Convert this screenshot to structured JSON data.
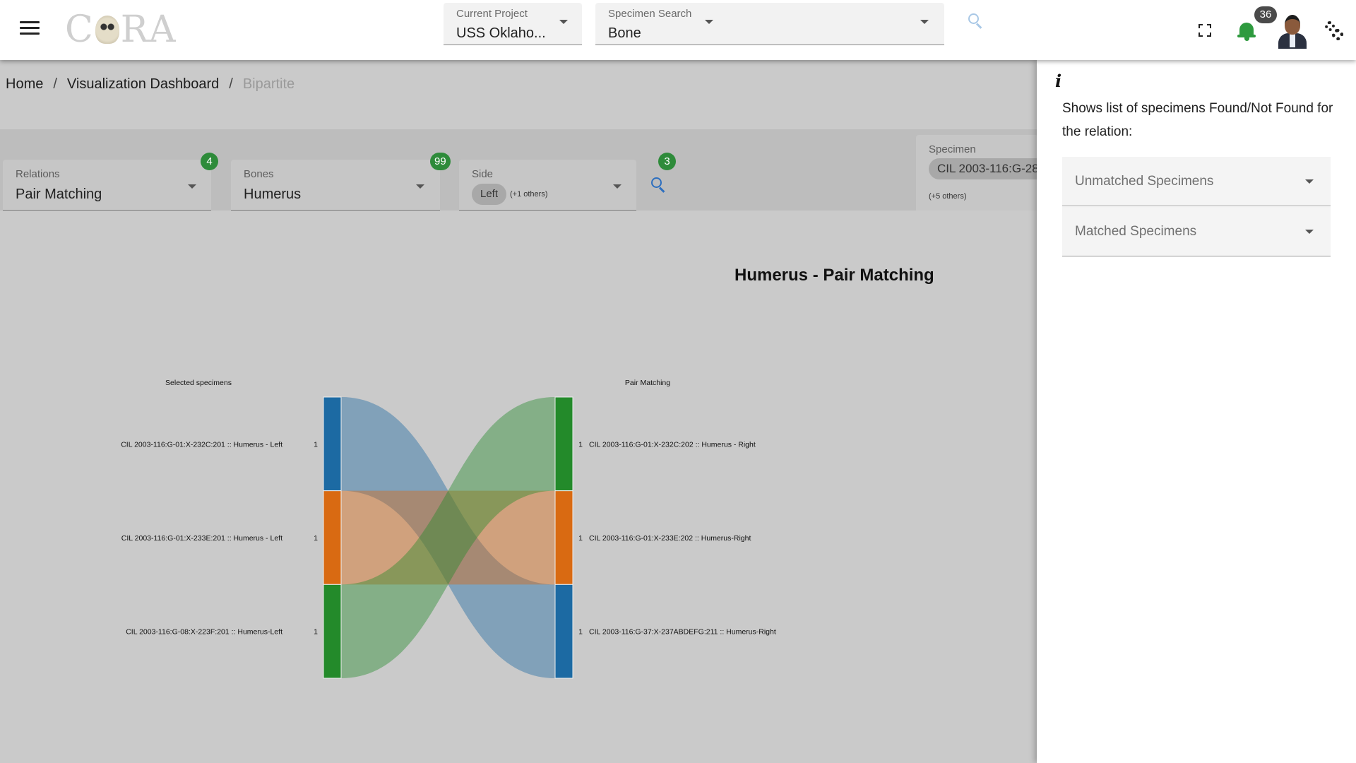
{
  "header": {
    "logo_text_left": "C",
    "logo_text_right": "RA",
    "current_project": {
      "label": "Current Project",
      "value": "USS Oklaho..."
    },
    "specimen_search": {
      "label": "Specimen Search",
      "value": "Bone"
    },
    "notifications_count": "36"
  },
  "breadcrumb": {
    "home": "Home",
    "dashboard": "Visualization Dashboard",
    "current": "Bipartite",
    "separator": "/"
  },
  "filters": {
    "relations": {
      "label": "Relations",
      "value": "Pair Matching",
      "count": "4"
    },
    "bones": {
      "label": "Bones",
      "value": "Humerus",
      "count": "99"
    },
    "side": {
      "label": "Side",
      "chip": "Left",
      "others": "(+1 others)"
    },
    "search_count": "3",
    "specimen": {
      "label": "Specimen",
      "chip": "CIL 2003-116:G-28",
      "others": "(+5 others)"
    }
  },
  "chart_data": {
    "type": "sankey",
    "title": "Humerus - Pair Matching",
    "left_header": "Selected specimens",
    "right_header": "Pair Matching",
    "left_nodes": [
      {
        "label": "CIL 2003-116:G-01:X-232C:201 :: Humerus - Left",
        "value": 1,
        "color": "#1c6aa3"
      },
      {
        "label": "CIL 2003-116:G-01:X-233E:201 :: Humerus - Left",
        "value": 1,
        "color": "#d96a12"
      },
      {
        "label": "CIL 2003-116:G-08:X-223F:201 :: Humerus-Left",
        "value": 1,
        "color": "#238a2a"
      }
    ],
    "right_nodes": [
      {
        "label": "CIL 2003-116:G-01:X-232C:202 :: Humerus - Right",
        "value": 1,
        "color": "#238a2a"
      },
      {
        "label": "CIL 2003-116:G-01:X-233E:202 :: Humerus-Right",
        "value": 1,
        "color": "#d96a12"
      },
      {
        "label": "CIL 2003-116:G-37:X-237ABDEFG:211 :: Humerus-Right",
        "value": 1,
        "color": "#1c6aa3"
      }
    ],
    "links": [
      {
        "source": 0,
        "target": 2,
        "value": 1
      },
      {
        "source": 1,
        "target": 1,
        "value": 1
      },
      {
        "source": 2,
        "target": 0,
        "value": 1
      }
    ]
  },
  "side_panel": {
    "info_icon": "i",
    "description": "Shows list of specimens Found/Not Found for the relation:",
    "unmatched": "Unmatched Specimens",
    "matched": "Matched Specimens"
  }
}
